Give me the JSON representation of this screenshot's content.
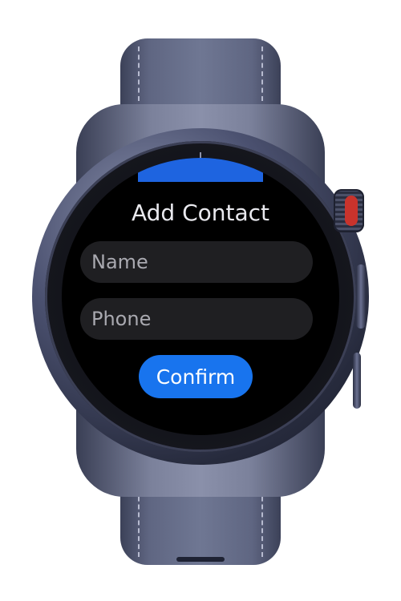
{
  "screen": {
    "title": "Add Contact",
    "name_input": {
      "value": "",
      "placeholder": "Name"
    },
    "phone_input": {
      "value": "",
      "placeholder": "Phone"
    },
    "confirm_label": "Confirm"
  },
  "colors": {
    "accent": "#1874ee",
    "screen_background": "#000000",
    "field_background": "#1f1f22",
    "top_indicator": "#1e64e0",
    "crown_ring": "#c9332c"
  }
}
